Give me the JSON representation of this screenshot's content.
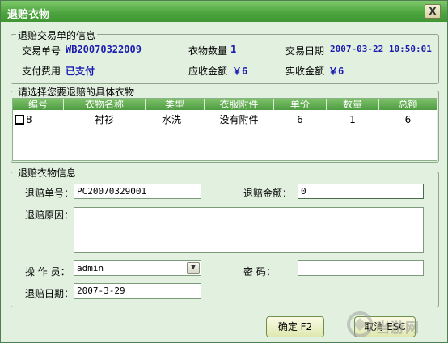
{
  "window": {
    "title": "退赔衣物",
    "close_label": "X"
  },
  "transaction": {
    "legend": "退赔交易单的信息",
    "order_no_label": "交易单号",
    "order_no": "WB20070322009",
    "item_count_label": "衣物数量",
    "item_count": "1",
    "date_label": "交易日期",
    "date": "2007-03-22 10:50:01",
    "payment_label": "支付费用",
    "payment": "已支付",
    "receivable_label": "应收金额",
    "receivable": "￥6",
    "received_label": "实收金额",
    "received": "￥6"
  },
  "item_select": {
    "legend": "请选择您要退赔的具体衣物",
    "columns": [
      "编号",
      "衣物名称",
      "类型",
      "衣服附件",
      "单价",
      "数量",
      "总额"
    ],
    "rows": [
      {
        "id": "8",
        "name": "衬衫",
        "type": "水洗",
        "attachment": "没有附件",
        "unit_price": "6",
        "quantity": "1",
        "total": "6"
      }
    ]
  },
  "refund": {
    "legend": "退赔衣物信息",
    "no_label": "退赔单号：",
    "no_value": "PC20070329001",
    "amount_label": "退赔金额：",
    "amount_value": "0",
    "reason_label": "退赔原因：",
    "reason_value": "",
    "operator_label": "操 作 员：",
    "operator_value": "admin",
    "password_label": "密    码：",
    "password_value": "",
    "date_label": "退赔日期：",
    "date_value": "2007-3-29"
  },
  "buttons": {
    "ok": "确定 F2",
    "cancel": "取消 ESC"
  },
  "watermark": {
    "text": "当游网"
  },
  "colors": {
    "titlebar": "#4ea640",
    "value_blue": "#1b1bb0",
    "background": "#e2f1df"
  }
}
